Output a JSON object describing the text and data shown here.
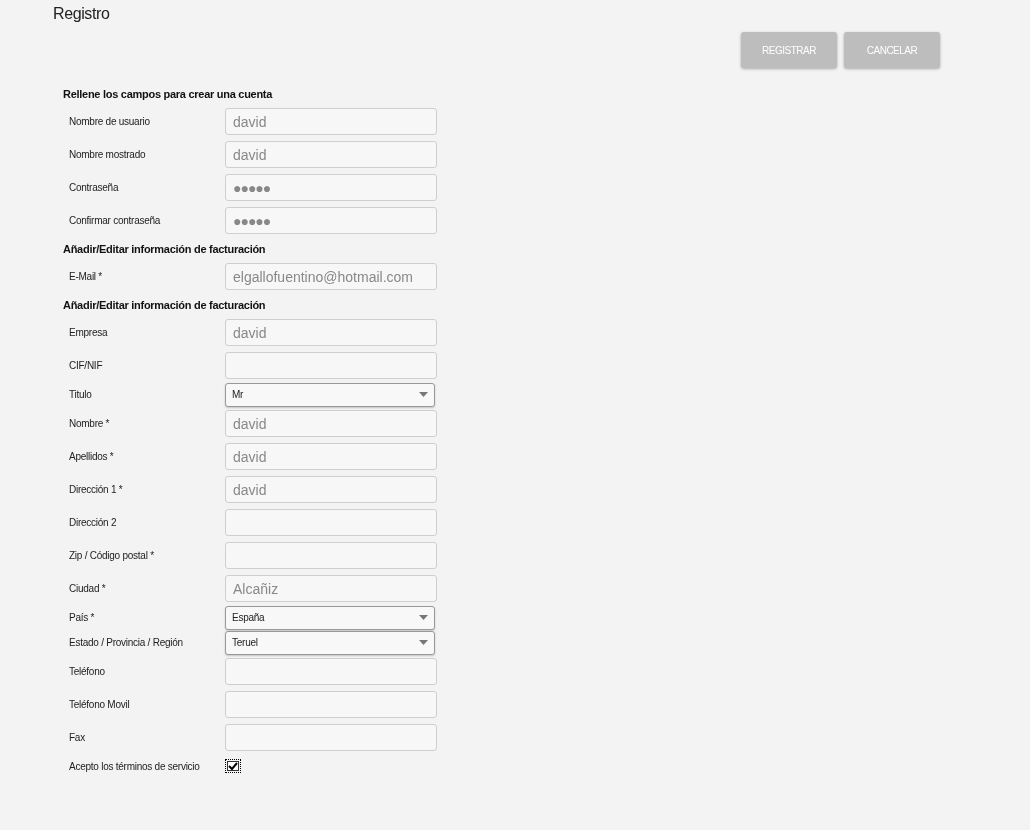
{
  "title": "Registro",
  "buttons": [
    "REGISTRAR",
    "CANCELAR"
  ],
  "sections": [
    {
      "heading": "Rellene los campos para crear una cuenta",
      "fields": [
        {
          "kind": "text",
          "label": "Nombre de usuario",
          "value": "david"
        },
        {
          "kind": "text",
          "label": "Nombre mostrado",
          "value": "david"
        },
        {
          "kind": "password",
          "label": "Contraseña",
          "value": "●●●●●"
        },
        {
          "kind": "password",
          "label": "Confirmar contraseña",
          "value": "●●●●●"
        }
      ]
    },
    {
      "heading": "Añadir/Editar información de facturación",
      "fields": [
        {
          "kind": "text",
          "label": "E-Mail *",
          "value": "elgallofuentino@hotmail.com"
        }
      ]
    },
    {
      "heading": "Añadir/Editar información de facturación",
      "fields": [
        {
          "kind": "text",
          "label": "Empresa",
          "value": "david"
        },
        {
          "kind": "text",
          "label": "CIF/NIF"
        },
        {
          "kind": "select",
          "label": "Titulo",
          "value": "Mr"
        },
        {
          "kind": "text",
          "label": "Nombre *",
          "value": "david"
        },
        {
          "kind": "text",
          "label": "Apellidos *",
          "value": "david"
        },
        {
          "kind": "text",
          "label": "Dirección 1 *",
          "value": "david"
        },
        {
          "kind": "text",
          "label": "Dirección 2"
        },
        {
          "kind": "text",
          "label": "Zip / Código postal *"
        },
        {
          "kind": "text",
          "label": "Ciudad *",
          "value": "Alcañiz"
        },
        {
          "kind": "select",
          "label": "País *",
          "value": "España"
        },
        {
          "kind": "select",
          "label": "Estado / Provincia / Región",
          "value": "Teruel"
        },
        {
          "kind": "text",
          "label": "Teléfono"
        },
        {
          "kind": "text",
          "label": "Teléfono Movil"
        },
        {
          "kind": "text",
          "label": "Fax"
        },
        {
          "kind": "checkbox",
          "label": "Acepto los términos de servicio",
          "checked": true
        }
      ]
    }
  ]
}
